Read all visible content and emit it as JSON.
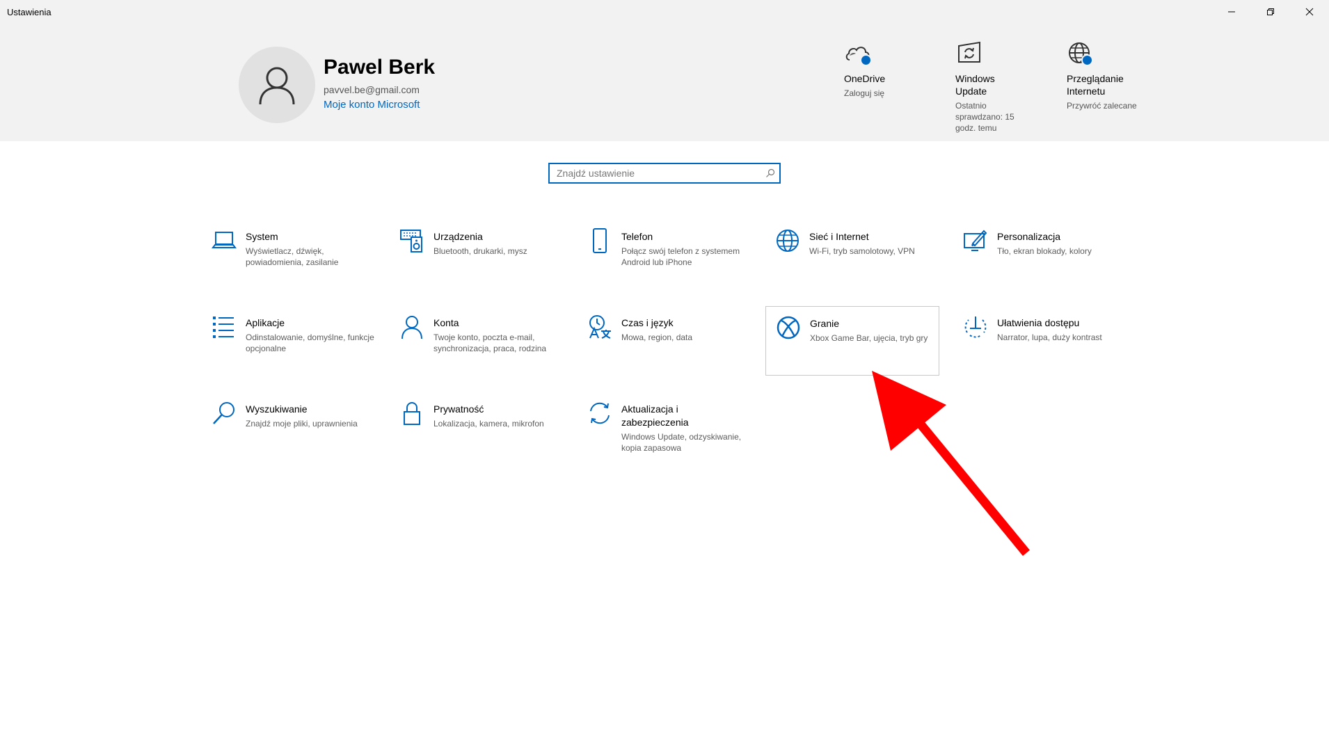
{
  "window": {
    "title": "Ustawienia"
  },
  "profile": {
    "name": "Pawel Berk",
    "email": "pavvel.be@gmail.com",
    "account_link": "Moje konto Microsoft"
  },
  "quick_items": [
    {
      "title": "OneDrive",
      "subtitle": "Zaloguj się",
      "icon": "onedrive-cloud-icon"
    },
    {
      "title": "Windows Update",
      "subtitle": "Ostatnio sprawdzano: 15 godz. temu",
      "icon": "windows-update-icon"
    },
    {
      "title": "Przeglądanie Internetu",
      "subtitle": "Przywróć zalecane",
      "icon": "globe-icon"
    }
  ],
  "search": {
    "placeholder": "Znajdź ustawienie",
    "value": ""
  },
  "tiles": [
    {
      "title": "System",
      "subtitle": "Wyświetlacz, dźwięk, powiadomienia, zasilanie",
      "icon": "laptop-icon"
    },
    {
      "title": "Urządzenia",
      "subtitle": "Bluetooth, drukarki, mysz",
      "icon": "devices-icon"
    },
    {
      "title": "Telefon",
      "subtitle": "Połącz swój telefon z systemem Android lub iPhone",
      "icon": "phone-icon"
    },
    {
      "title": "Sieć i Internet",
      "subtitle": "Wi-Fi, tryb samolotowy, VPN",
      "icon": "globe-icon"
    },
    {
      "title": "Personalizacja",
      "subtitle": "Tło, ekran blokady, kolory",
      "icon": "personalization-icon"
    },
    {
      "title": "Aplikacje",
      "subtitle": "Odinstalowanie, domyślne, funkcje opcjonalne",
      "icon": "apps-list-icon"
    },
    {
      "title": "Konta",
      "subtitle": "Twoje konto, poczta e-mail, synchronizacja, praca, rodzina",
      "icon": "person-icon"
    },
    {
      "title": "Czas i język",
      "subtitle": "Mowa, region, data",
      "icon": "time-language-icon"
    },
    {
      "title": "Granie",
      "subtitle": "Xbox Game Bar, ujęcia, tryb gry",
      "icon": "xbox-icon"
    },
    {
      "title": "Ułatwienia dostępu",
      "subtitle": "Narrator, lupa, duży kontrast",
      "icon": "accessibility-icon"
    },
    {
      "title": "Wyszukiwanie",
      "subtitle": "Znajdź moje pliki, uprawnienia",
      "icon": "search-icon"
    },
    {
      "title": "Prywatność",
      "subtitle": "Lokalizacja, kamera, mikrofon",
      "icon": "lock-icon"
    },
    {
      "title": "Aktualizacja i zabezpieczenia",
      "subtitle": "Windows Update, odzyskiwanie, kopia zapasowa",
      "icon": "update-sync-icon"
    }
  ],
  "annotation": {
    "type": "red-arrow",
    "points_to": "Granie",
    "color": "#ff0000"
  },
  "colors": {
    "accent": "#0067c0",
    "header_background": "#f2f2f2"
  }
}
